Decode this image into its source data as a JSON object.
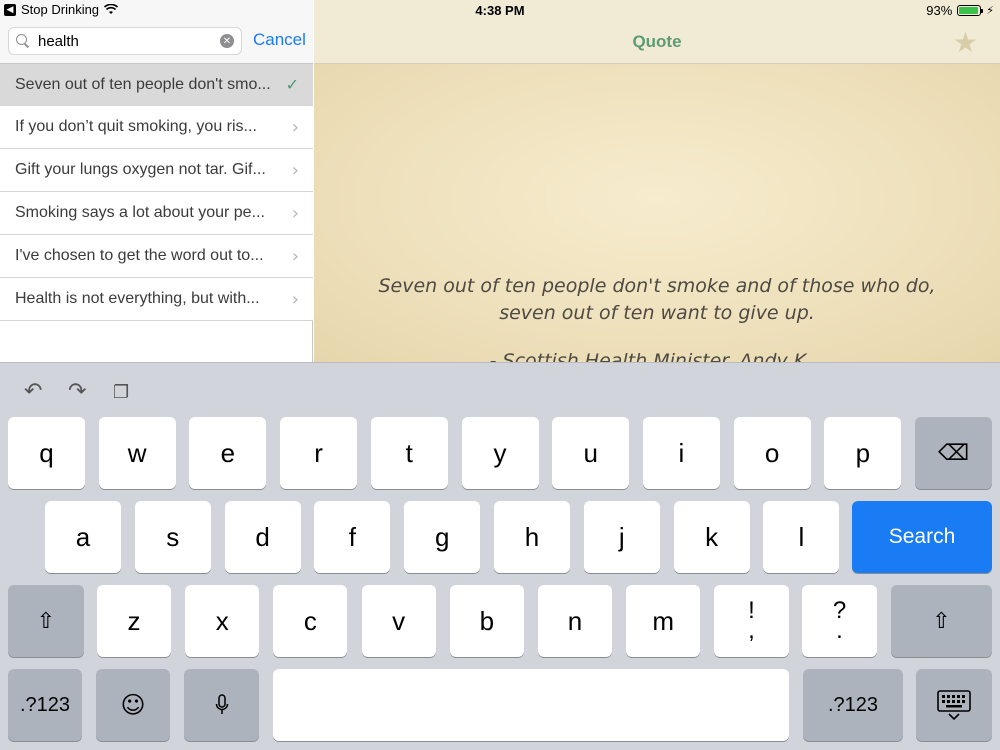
{
  "status_bar": {
    "back_app": "Stop Drinking",
    "time": "4:38 PM",
    "battery_percent": "93%",
    "battery_level": 0.93,
    "icons": [
      "back-chevron-icon",
      "wifi-icon",
      "battery-icon",
      "charging-bolt-icon"
    ]
  },
  "search": {
    "value": "health",
    "cancel_label": "Cancel"
  },
  "results": [
    {
      "text": "Seven out of ten people don't smo...",
      "selected": true
    },
    {
      "text": "If you don’t quit smoking, you ris...",
      "selected": false
    },
    {
      "text": "Gift your lungs oxygen not tar. Gif...",
      "selected": false
    },
    {
      "text": "Smoking says a lot about your pe...",
      "selected": false
    },
    {
      "text": "I've chosen to get the word out to...",
      "selected": false
    },
    {
      "text": "Health is not everything, but with...",
      "selected": false
    }
  ],
  "detail": {
    "title": "Quote",
    "quote": "Seven out of ten people don't smoke and of those who do, seven out of ten want to give up.",
    "author_partial": "- Scottish Health Minister, Andy K..."
  },
  "keyboard": {
    "row1": [
      "q",
      "w",
      "e",
      "r",
      "t",
      "y",
      "u",
      "i",
      "o",
      "p"
    ],
    "row2": [
      "a",
      "s",
      "d",
      "f",
      "g",
      "h",
      "j",
      "k",
      "l"
    ],
    "row3": [
      "z",
      "x",
      "c",
      "v",
      "b",
      "n",
      "m"
    ],
    "punct1": {
      "top": "!",
      "bottom": ","
    },
    "punct2": {
      "top": "?",
      "bottom": "."
    },
    "search_label": "Search",
    "numbers_label": ".?123",
    "accent_color": "#1a7cf5"
  }
}
